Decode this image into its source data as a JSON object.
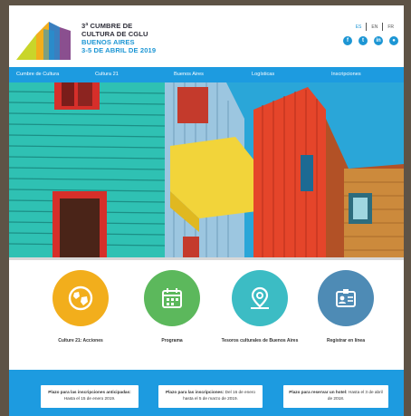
{
  "header": {
    "title_lines": [
      "3ª CUMBRE DE",
      "CULTURA DE CGLU",
      "BUENOS AIRES",
      "3-5 DE ABRIL DE 2019"
    ],
    "languages": [
      "ES",
      "EN",
      "FR"
    ],
    "active_language": "ES",
    "social": [
      {
        "icon": "facebook-icon",
        "glyph": "f"
      },
      {
        "icon": "twitter-icon",
        "glyph": "t"
      },
      {
        "icon": "linkedin-icon",
        "glyph": "in"
      },
      {
        "icon": "flickr-icon",
        "glyph": "●"
      }
    ]
  },
  "nav": {
    "items": [
      "Cumbre de Cultura",
      "Cultura 21",
      "Buenos Aires",
      "Logísticas",
      "Inscripciones"
    ]
  },
  "actions": [
    {
      "label": "Culture 21: Acciones",
      "color": "#f2ae1c",
      "icon": "globe-icon"
    },
    {
      "label": "Programa",
      "color": "#5cb85c",
      "icon": "calendar-icon"
    },
    {
      "label": "Tesoros culturales de Buenos Aires",
      "color": "#3cbcc4",
      "icon": "map-pin-icon"
    },
    {
      "label": "Registrar en línea",
      "color": "#4e8bb5",
      "icon": "id-card-icon"
    }
  ],
  "cards": [
    {
      "bold": "Plazo para las inscripciones anticipadas:",
      "text": " Hasta el 15 de enero 2019."
    },
    {
      "bold": "Plazo para las inscripciones:",
      "text": " Del 16 de enero hasta el 5 de marzo de 2019."
    },
    {
      "bold": "Plazo para reservar un hotel:",
      "text": " Hasta el 3 de abril de 2018."
    }
  ],
  "colors": {
    "accent": "#1d9be0",
    "background": "#5e5346"
  }
}
